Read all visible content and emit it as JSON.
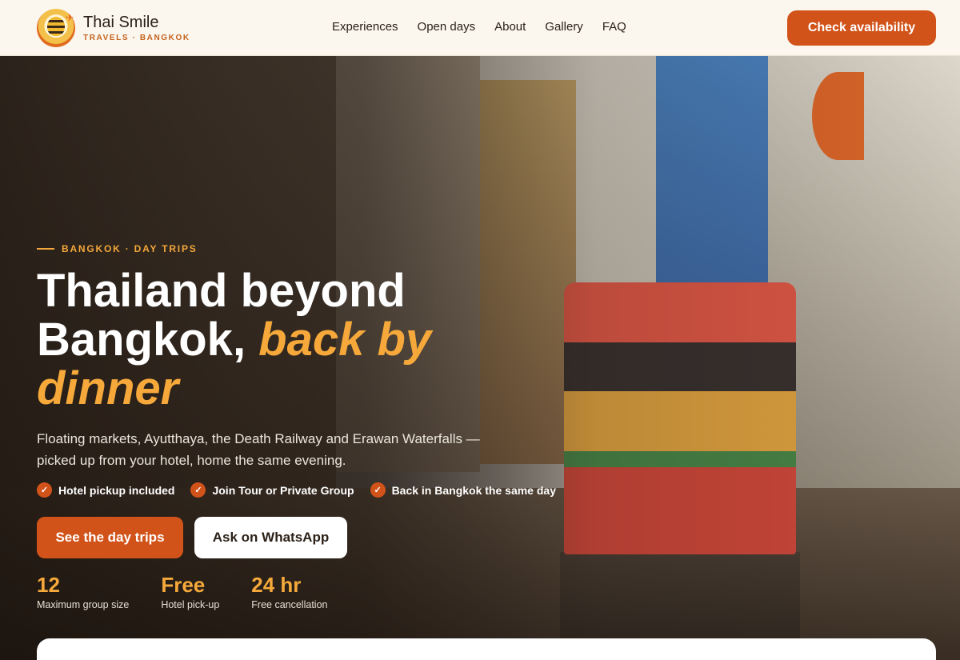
{
  "header": {
    "brand_name": "Thai Smile",
    "brand_sub": "TRAVELS · BANGKOK",
    "nav": [
      "Experiences",
      "Open days",
      "About",
      "Gallery",
      "FAQ"
    ],
    "cta": "Check availability"
  },
  "hero": {
    "eyebrow": "BANGKOK · DAY TRIPS",
    "headline_1": "Thailand beyond",
    "headline_2": "Bangkok, ",
    "headline_accent": "back by dinner",
    "subtitle": "Floating markets, Ayutthaya, the Death Railway and Erawan Waterfalls — picked up from your hotel, home the same evening.",
    "features": [
      "Hotel pickup included",
      "Join Tour or Private Group",
      "Back in Bangkok the same day"
    ],
    "primary_button": "See the day trips",
    "secondary_button": "Ask on WhatsApp",
    "stats": [
      {
        "value": "12",
        "label": "Maximum group size"
      },
      {
        "value": "Free",
        "label": "Hotel pick-up"
      },
      {
        "value": "24 hr",
        "label": "Free cancellation"
      }
    ]
  },
  "colors": {
    "accent": "#d2531a",
    "highlight": "#f6a93a",
    "header_bg": "#fbf6ee"
  },
  "icons": {
    "logo": "bee-logo-icon",
    "check": "check-icon"
  }
}
